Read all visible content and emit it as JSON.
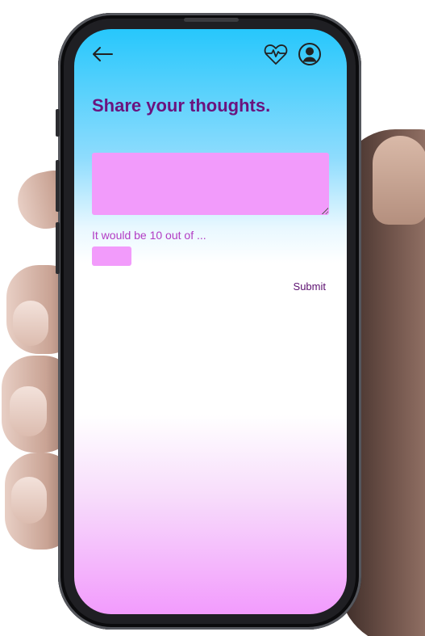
{
  "header": {
    "back_icon": "arrow-left-icon",
    "health_icon": "heart-pulse-icon",
    "profile_icon": "user-circle-icon"
  },
  "main": {
    "title": "Share your thoughts.",
    "thoughts_value": "",
    "rating_label": "It would be 10 out of ...",
    "rating_value": "",
    "submit_label": "Submit"
  },
  "colors": {
    "title": "#6b137e",
    "field_bg": "#f29bfb",
    "label": "#b13cc4",
    "gradient_top": "#27c7fc",
    "gradient_bottom": "#f29bfd"
  }
}
